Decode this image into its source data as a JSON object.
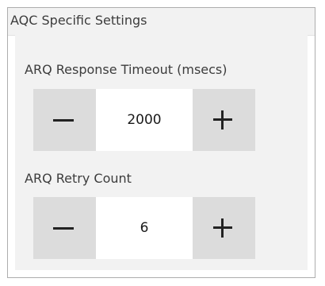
{
  "panel": {
    "title": "AQC Specific Settings"
  },
  "fields": [
    {
      "label": "ARQ Response Timeout (msecs)",
      "value": "2000",
      "decrement_icon": "minus-icon",
      "increment_icon": "plus-icon"
    },
    {
      "label": "ARQ Retry Count",
      "value": "6",
      "decrement_icon": "minus-icon",
      "increment_icon": "plus-icon"
    }
  ],
  "colors": {
    "panel_border": "#adadad",
    "panel_background": "#f2f2f2",
    "stepper_button": "#dcdcdc",
    "stepper_value_background": "#ffffff",
    "icon": "#222222",
    "text": "#3c3c3c"
  }
}
